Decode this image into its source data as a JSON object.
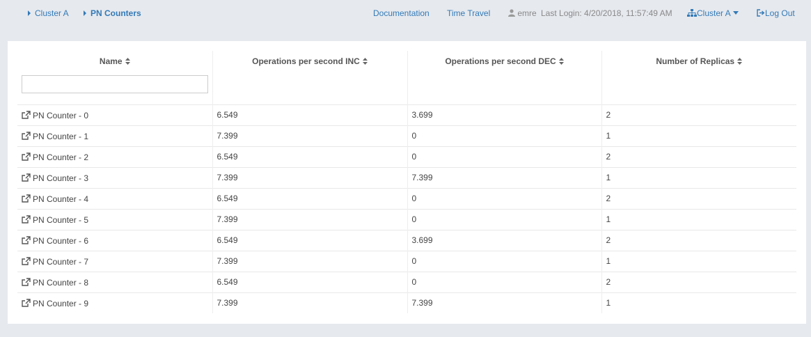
{
  "breadcrumb": [
    {
      "label": "Cluster A",
      "active": false
    },
    {
      "label": "PN Counters",
      "active": true
    }
  ],
  "nav": {
    "documentation": "Documentation",
    "time_travel": "Time Travel",
    "user": "emre",
    "last_login": "Last Login: 4/20/2018, 11:57:49 AM",
    "cluster_menu": "Cluster A",
    "logout": "Log Out"
  },
  "table": {
    "columns": [
      "Name",
      "Operations per second INC",
      "Operations per second DEC",
      "Number of Replicas"
    ],
    "filter_value": "",
    "rows": [
      {
        "name": "PN Counter - 0",
        "inc": "6.549",
        "dec": "3.699",
        "replicas": "2"
      },
      {
        "name": "PN Counter - 1",
        "inc": "7.399",
        "dec": "0",
        "replicas": "1"
      },
      {
        "name": "PN Counter - 2",
        "inc": "6.549",
        "dec": "0",
        "replicas": "2"
      },
      {
        "name": "PN Counter - 3",
        "inc": "7.399",
        "dec": "7.399",
        "replicas": "1"
      },
      {
        "name": "PN Counter - 4",
        "inc": "6.549",
        "dec": "0",
        "replicas": "2"
      },
      {
        "name": "PN Counter - 5",
        "inc": "7.399",
        "dec": "0",
        "replicas": "1"
      },
      {
        "name": "PN Counter - 6",
        "inc": "6.549",
        "dec": "3.699",
        "replicas": "2"
      },
      {
        "name": "PN Counter - 7",
        "inc": "7.399",
        "dec": "0",
        "replicas": "1"
      },
      {
        "name": "PN Counter - 8",
        "inc": "6.549",
        "dec": "0",
        "replicas": "2"
      },
      {
        "name": "PN Counter - 9",
        "inc": "7.399",
        "dec": "7.399",
        "replicas": "1"
      }
    ]
  },
  "icons": {
    "crumb_caret": "caret-right-icon",
    "user": "user-icon",
    "cluster": "sitemap-icon",
    "logout": "sign-out-icon",
    "sort": "sort-icon",
    "row_link": "external-link-icon"
  },
  "colors": {
    "link": "#337ab7",
    "background": "#e6e9ee",
    "panel": "#ffffff"
  }
}
